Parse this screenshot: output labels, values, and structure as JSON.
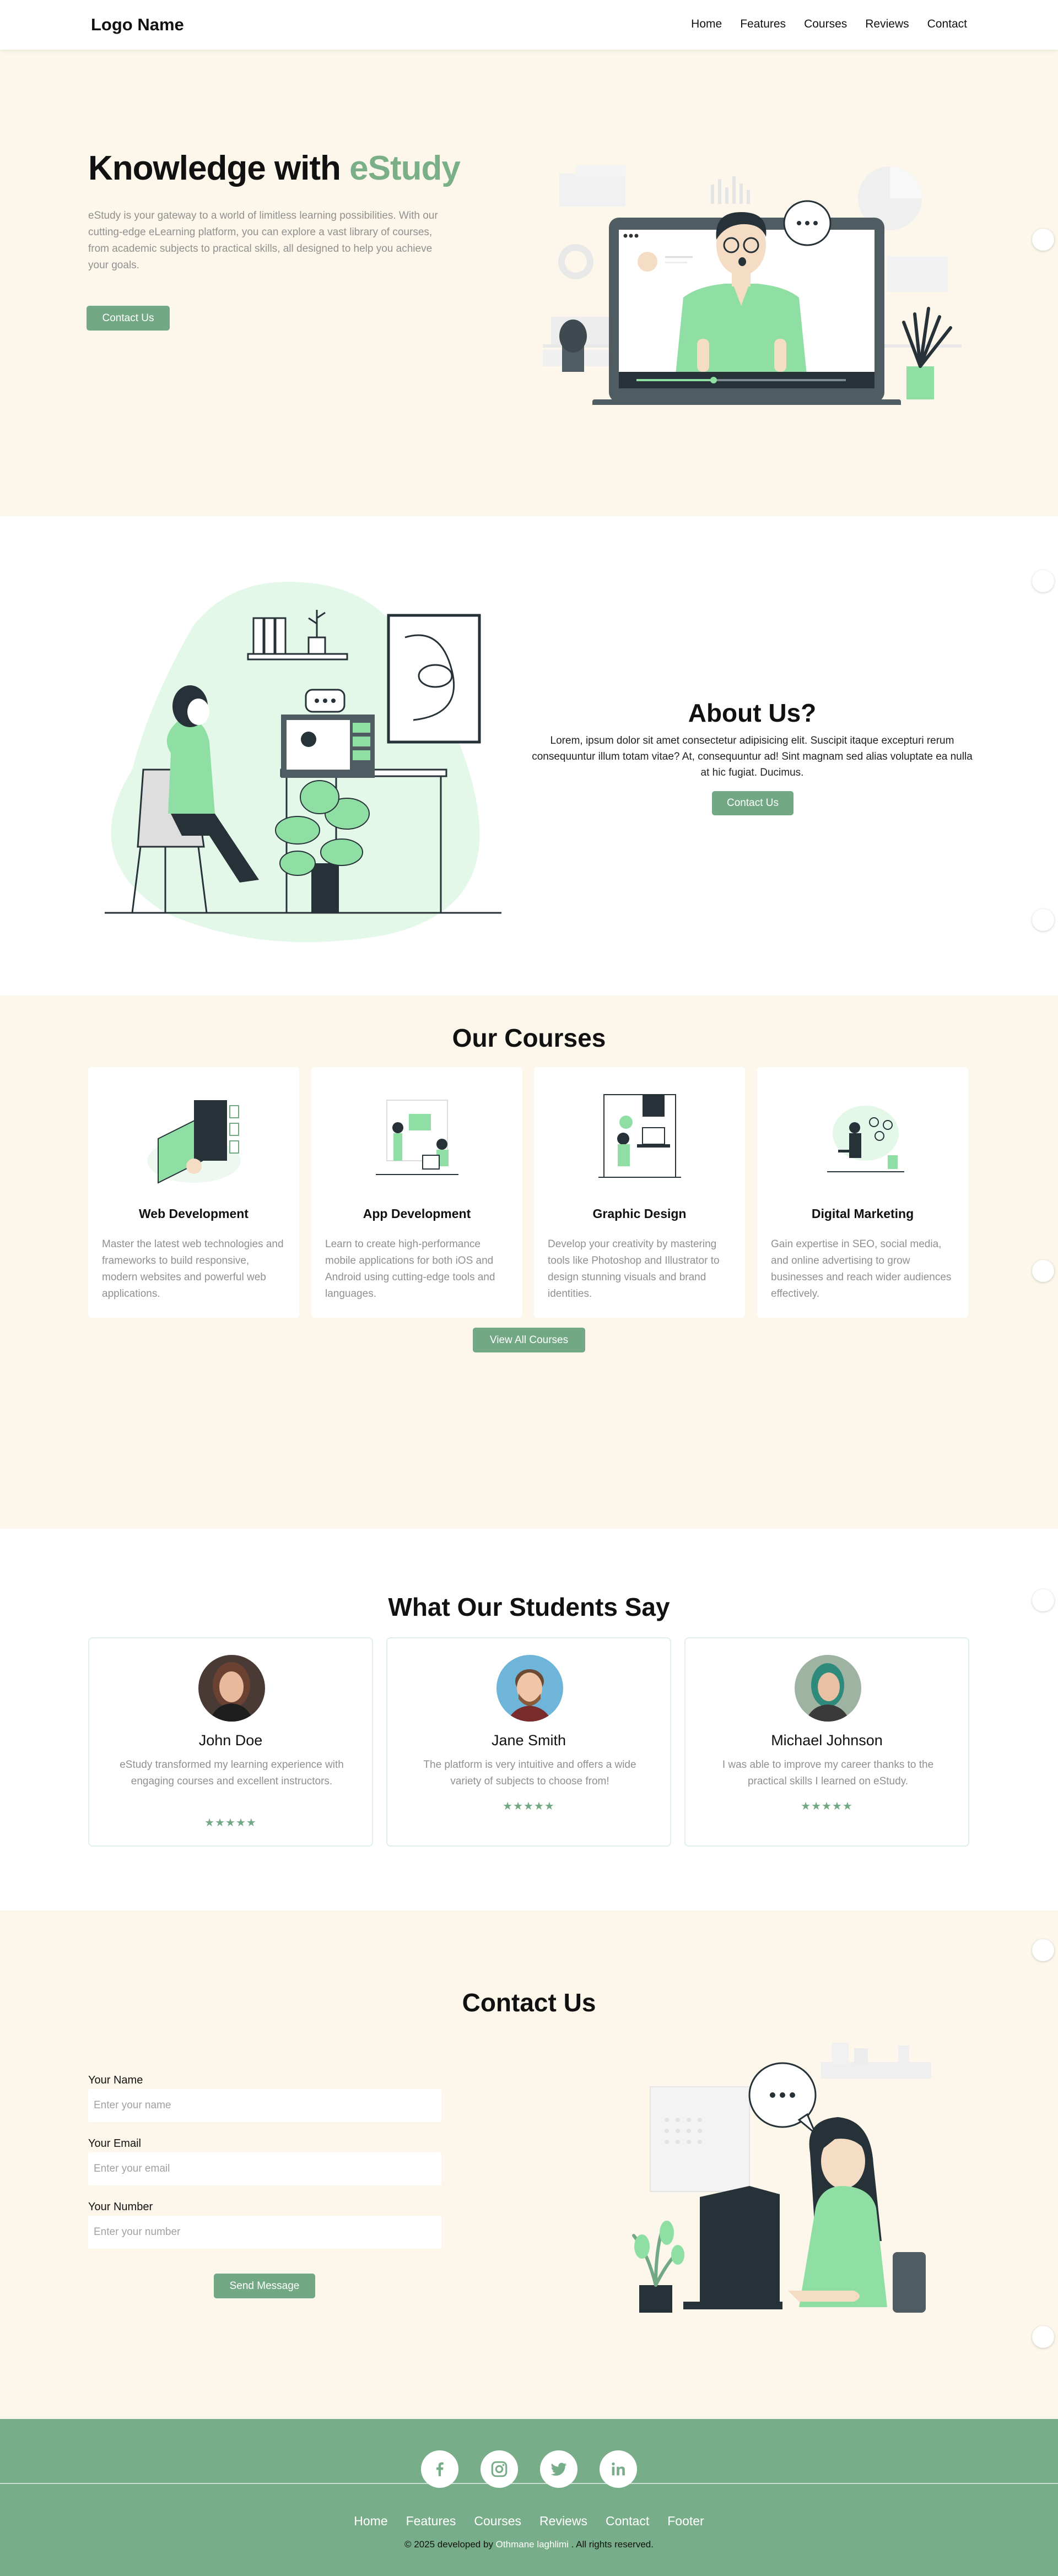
{
  "nav": {
    "logo": "Logo Name",
    "links": [
      "Home",
      "Features",
      "Courses",
      "Reviews",
      "Contact"
    ]
  },
  "hero": {
    "title_main": "Knowledge with ",
    "title_accent": "eStudy",
    "description": "eStudy is your gateway to a world of limitless learning possibilities. With our cutting-edge eLearning platform, you can explore a vast library of courses, from academic subjects to practical skills, all designed to help you achieve your goals.",
    "button": "Contact Us"
  },
  "about": {
    "title": "About Us?",
    "text": "Lorem, ipsum dolor sit amet consectetur adipisicing elit. Suscipit itaque excepturi rerum consequuntur illum totam vitae? At, consequuntur ad! Sint magnam sed alias voluptate ea nulla at hic fugiat. Ducimus.",
    "button": "Contact Us"
  },
  "courses": {
    "title": "Our Courses",
    "items": [
      {
        "name": "Web Development",
        "description": "Master the latest web technologies and frameworks to build responsive, modern websites and powerful web applications."
      },
      {
        "name": "App Development",
        "description": "Learn to create high-performance mobile applications for both iOS and Android using cutting-edge tools and languages."
      },
      {
        "name": "Graphic Design",
        "description": "Develop your creativity by mastering tools like Photoshop and Illustrator to design stunning visuals and brand identities."
      },
      {
        "name": "Digital Marketing",
        "description": "Gain expertise in SEO, social media, and online advertising to grow businesses and reach wider audiences effectively."
      }
    ],
    "button": "View All Courses"
  },
  "testimonials": {
    "title": "What Our Students Say",
    "items": [
      {
        "name": "John Doe",
        "text": "eStudy transformed my learning experience with engaging courses and excellent instructors.",
        "stars": "★★★★★",
        "rating": 5
      },
      {
        "name": "Jane Smith",
        "text": "The platform is very intuitive and offers a wide variety of subjects to choose from!",
        "stars": "★★★★★",
        "rating": 5
      },
      {
        "name": "Michael Johnson",
        "text": "I was able to improve my career thanks to the practical skills I learned on eStudy.",
        "stars": "★★★★★",
        "rating": 5
      }
    ]
  },
  "contact": {
    "title": "Contact Us",
    "fields": [
      {
        "label": "Your Name",
        "placeholder": "Enter your name"
      },
      {
        "label": "Your Email",
        "placeholder": "Enter your email"
      },
      {
        "label": "Your Number",
        "placeholder": "Enter your number"
      }
    ],
    "button": "Send Message"
  },
  "footer": {
    "socials": [
      "facebook-icon",
      "instagram-icon",
      "twitter-icon",
      "linkedin-icon"
    ],
    "links": [
      "Home",
      "Features",
      "Courses",
      "Reviews",
      "Contact",
      "Footer"
    ],
    "copyright_prefix": "© 2025 developed by ",
    "author": "Othmane laghlimi",
    "copyright_suffix": " . All rights reserved."
  },
  "colors": {
    "accent": "#73a885",
    "cream": "#fcf7ea",
    "footer": "#78ad8a",
    "mint": "#d9f5e1"
  }
}
